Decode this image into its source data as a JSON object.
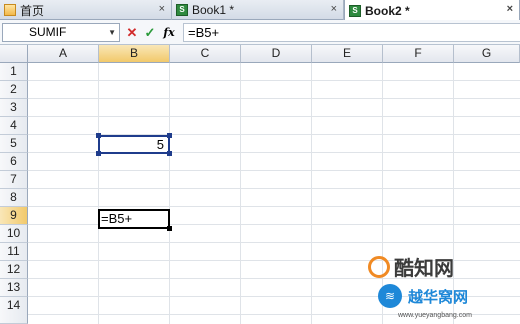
{
  "tabs": [
    {
      "label": "首页",
      "close": "×"
    },
    {
      "label": "Book1 *",
      "close": "×"
    },
    {
      "label": "Book2 *",
      "close": "×"
    }
  ],
  "formula_bar": {
    "name_box": "SUMIF",
    "cancel_glyph": "✕",
    "enter_glyph": "✓",
    "fx_label": "fx",
    "content": "=B5+"
  },
  "columns": [
    "A",
    "B",
    "C",
    "D",
    "E",
    "F",
    "G"
  ],
  "rows": [
    "1",
    "2",
    "3",
    "4",
    "5",
    "6",
    "7",
    "8",
    "9",
    "10",
    "11",
    "12",
    "13",
    "14"
  ],
  "cells": {
    "B5": "5",
    "B9": "=B5+"
  },
  "watermark": {
    "line1": "酷知网",
    "line2": "越华窝网",
    "url": "www.yueyangbang.com"
  }
}
